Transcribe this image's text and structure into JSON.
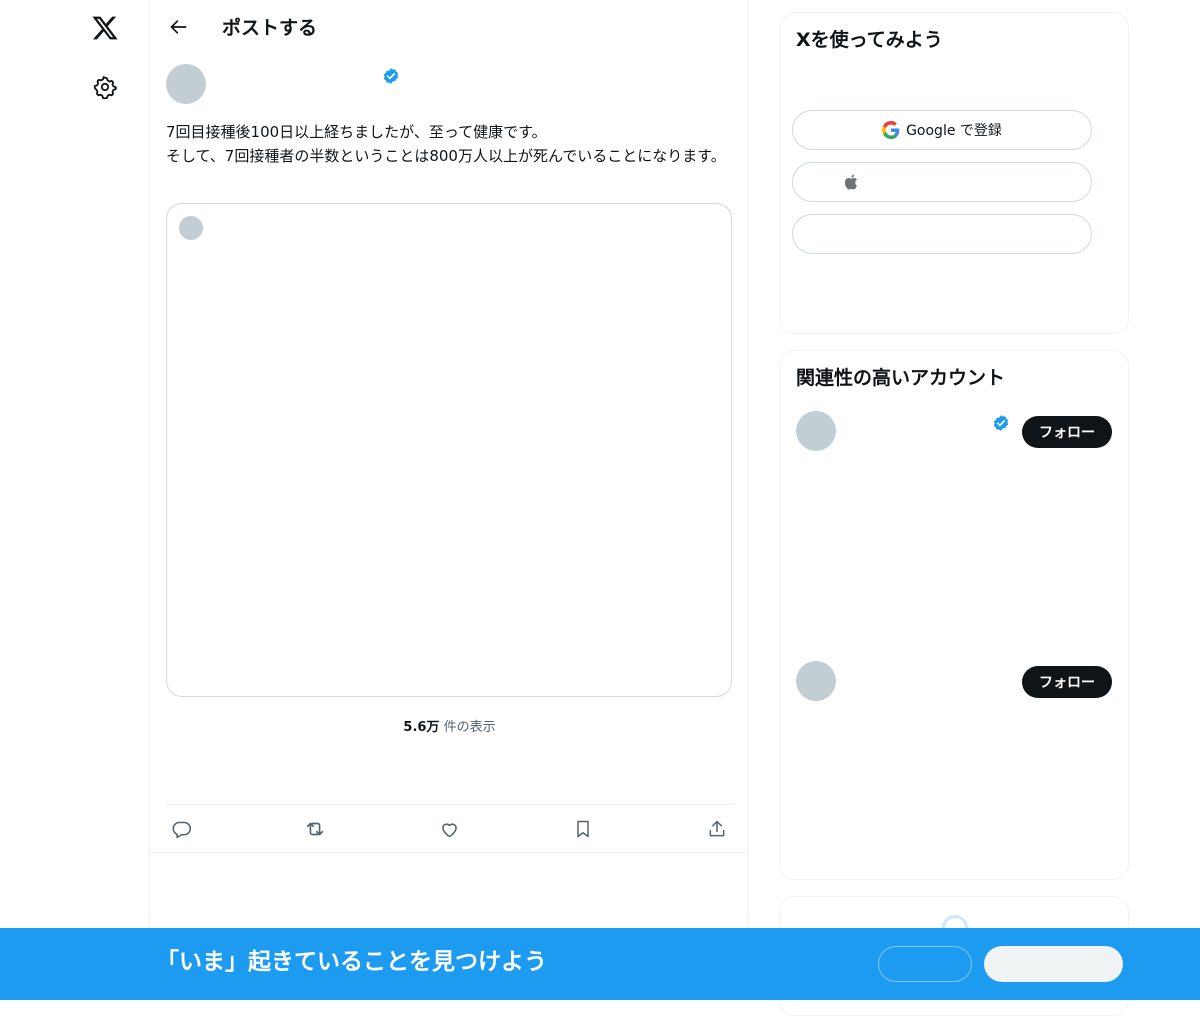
{
  "header": {
    "title": "ポストする"
  },
  "post": {
    "text": "7回目接種後100日以上経ちましたが、至って健康です。\nそして、7回接種者の半数ということは800万人以上が死んでいることになります。",
    "views_count": "5.6万",
    "views_label": " 件の表示"
  },
  "signup": {
    "title": "Xを使ってみよう",
    "google_label": "Google で登録"
  },
  "related": {
    "title": "関連性の高いアカウント",
    "follow_label": "フォロー"
  },
  "bottom_bar": {
    "text": "「いま」起きていることを見つけよう"
  },
  "colors": {
    "accent": "#1d9bf0",
    "text": "#0f1419",
    "muted": "#536471",
    "border": "#eff3f4",
    "placeholder": "#c2cdd4"
  },
  "icons": {
    "nav": [
      "x-logo-icon",
      "gear-icon"
    ],
    "header": "back-arrow-icon",
    "actions": [
      "reply-icon",
      "repost-icon",
      "like-icon",
      "bookmark-icon",
      "share-icon"
    ]
  }
}
